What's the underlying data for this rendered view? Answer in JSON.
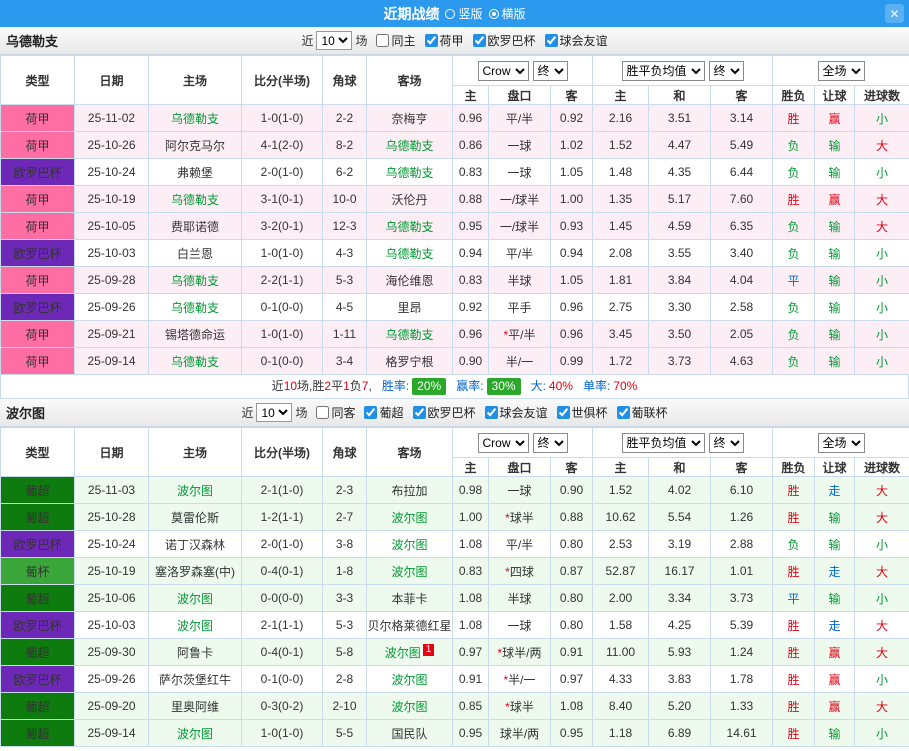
{
  "topbar": {
    "title": "近期战绩",
    "radios": [
      {
        "label": "竖版",
        "selected": false
      },
      {
        "label": "横版",
        "selected": true
      }
    ],
    "close_label": "✕"
  },
  "table_header": {
    "static": [
      "类型",
      "日期",
      "主场",
      "比分(半场)",
      "角球",
      "客场"
    ],
    "groups": [
      {
        "selects": [
          "Crow",
          "终"
        ]
      },
      {
        "selects": [
          "胜平负均值",
          "终"
        ]
      },
      {
        "selects": [
          "全场"
        ]
      }
    ],
    "sub": [
      "主",
      "盘口",
      "客",
      "主",
      "和",
      "客",
      "胜负",
      "让球",
      "进球数"
    ]
  },
  "colors": {
    "topbar_bg": "#2b99ee",
    "league": {
      "荷甲": "#ff6ea2",
      "欧罗巴杯": "#6d28b8",
      "葡超": "#0e7b0e",
      "葡杯": "#3aa63a"
    },
    "row_tint": {
      "荷甲": "#fdeef5",
      "欧罗巴杯": "#ffffff",
      "葡超": "#edfaed",
      "葡杯": "#edfaed"
    },
    "win": "#e60012",
    "loss": "#009933",
    "draw": "#0066cc",
    "score": "#e60012",
    "team_focus": "#009933",
    "badge_bg": "#2aa82a"
  },
  "sections": [
    {
      "team": "乌德勒支",
      "filter": {
        "recent_prefix": "近",
        "recent_value": "10",
        "recent_suffix": "场",
        "checkboxes": [
          {
            "label": "同主",
            "checked": false
          },
          {
            "label": "荷甲",
            "checked": true
          },
          {
            "label": "欧罗巴杯",
            "checked": true
          },
          {
            "label": "球会友谊",
            "checked": true
          }
        ]
      },
      "rows": [
        {
          "league": "荷甲",
          "date": "25-11-02",
          "home": "乌德勒支",
          "score": "1-0(1-0)",
          "corners": "2-2",
          "away": "奈梅亨",
          "o1": "0.96",
          "handicap": "平/半",
          "o2": "0.92",
          "eu1": "2.16",
          "eux": "3.51",
          "eu2": "3.14",
          "res": "胜",
          "hres": "赢",
          "goals": "小"
        },
        {
          "league": "荷甲",
          "date": "25-10-26",
          "home": "阿尔克马尔",
          "score": "4-1(2-0)",
          "corners": "8-2",
          "away": "乌德勒支",
          "o1": "0.86",
          "handicap": "一球",
          "o2": "1.02",
          "eu1": "1.52",
          "eux": "4.47",
          "eu2": "5.49",
          "res": "负",
          "hres": "输",
          "goals": "大"
        },
        {
          "league": "欧罗巴杯",
          "date": "25-10-24",
          "home": "弗赖堡",
          "score": "2-0(1-0)",
          "corners": "6-2",
          "away": "乌德勒支",
          "o1": "0.83",
          "handicap": "一球",
          "o2": "1.05",
          "eu1": "1.48",
          "eux": "4.35",
          "eu2": "6.44",
          "res": "负",
          "hres": "输",
          "goals": "小"
        },
        {
          "league": "荷甲",
          "date": "25-10-19",
          "home": "乌德勒支",
          "score": "3-1(0-1)",
          "corners": "10-0",
          "away": "沃伦丹",
          "o1": "0.88",
          "handicap": "一/球半",
          "o2": "1.00",
          "eu1": "1.35",
          "eux": "5.17",
          "eu2": "7.60",
          "res": "胜",
          "hres": "赢",
          "goals": "大"
        },
        {
          "league": "荷甲",
          "date": "25-10-05",
          "home": "费耶诺德",
          "score": "3-2(0-1)",
          "corners": "12-3",
          "away": "乌德勒支",
          "o1": "0.95",
          "handicap": "一/球半",
          "o2": "0.93",
          "eu1": "1.45",
          "eux": "4.59",
          "eu2": "6.35",
          "res": "负",
          "hres": "输",
          "goals": "大"
        },
        {
          "league": "欧罗巴杯",
          "date": "25-10-03",
          "home": "白兰恩",
          "score": "1-0(1-0)",
          "corners": "4-3",
          "away": "乌德勒支",
          "o1": "0.94",
          "handicap": "平/半",
          "o2": "0.94",
          "eu1": "2.08",
          "eux": "3.55",
          "eu2": "3.40",
          "res": "负",
          "hres": "输",
          "goals": "小"
        },
        {
          "league": "荷甲",
          "date": "25-09-28",
          "home": "乌德勒支",
          "score": "2-2(1-1)",
          "corners": "5-3",
          "away": "海伦维恩",
          "o1": "0.83",
          "handicap": "半球",
          "o2": "1.05",
          "eu1": "1.81",
          "eux": "3.84",
          "eu2": "4.04",
          "res": "平",
          "hres": "输",
          "goals": "小"
        },
        {
          "league": "欧罗巴杯",
          "date": "25-09-26",
          "home": "乌德勒支",
          "score": "0-1(0-0)",
          "corners": "4-5",
          "away": "里昂",
          "o1": "0.92",
          "handicap": "平手",
          "o2": "0.96",
          "eu1": "2.75",
          "eux": "3.30",
          "eu2": "2.58",
          "res": "负",
          "hres": "输",
          "goals": "小"
        },
        {
          "league": "荷甲",
          "date": "25-09-21",
          "home": "锡塔德命运",
          "score": "1-0(1-0)",
          "corners": "1-11",
          "away": "乌德勒支",
          "o1": "0.96",
          "handicap": "*平/半",
          "o2": "0.96",
          "eu1": "3.45",
          "eux": "3.50",
          "eu2": "2.05",
          "res": "负",
          "hres": "输",
          "goals": "小"
        },
        {
          "league": "荷甲",
          "date": "25-09-14",
          "home": "乌德勒支",
          "score": "0-1(0-0)",
          "corners": "3-4",
          "away": "格罗宁根",
          "o1": "0.90",
          "handicap": "半/一",
          "o2": "0.99",
          "eu1": "1.72",
          "eux": "3.73",
          "eu2": "4.63",
          "res": "负",
          "hres": "输",
          "goals": "小"
        }
      ],
      "summary": {
        "games": "10",
        "record": "胜2平1负7",
        "win_rate_label": "胜率:",
        "win_rate": "20%",
        "handicap_rate_label": "赢率:",
        "handicap_rate": "30%",
        "big_label": "大:",
        "big_rate": "40%",
        "single_label": "单率:",
        "single_rate": "70%"
      }
    },
    {
      "team": "波尔图",
      "filter": {
        "recent_prefix": "近",
        "recent_value": "10",
        "recent_suffix": "场",
        "checkboxes": [
          {
            "label": "同客",
            "checked": false
          },
          {
            "label": "葡超",
            "checked": true
          },
          {
            "label": "欧罗巴杯",
            "checked": true
          },
          {
            "label": "球会友谊",
            "checked": true
          },
          {
            "label": "世俱杯",
            "checked": true
          },
          {
            "label": "葡联杯",
            "checked": true
          }
        ]
      },
      "rows": [
        {
          "league": "葡超",
          "date": "25-11-03",
          "home": "波尔图",
          "score": "2-1(1-0)",
          "corners": "2-3",
          "away": "布拉加",
          "o1": "0.98",
          "handicap": "一球",
          "o2": "0.90",
          "eu1": "1.52",
          "eux": "4.02",
          "eu2": "6.10",
          "res": "胜",
          "hres": "走",
          "goals": "大"
        },
        {
          "league": "葡超",
          "date": "25-10-28",
          "home": "莫雷伦斯",
          "score": "1-2(1-1)",
          "corners": "2-7",
          "away": "波尔图",
          "o1": "1.00",
          "handicap": "*球半",
          "o2": "0.88",
          "eu1": "10.62",
          "eux": "5.54",
          "eu2": "1.26",
          "res": "胜",
          "hres": "输",
          "goals": "大"
        },
        {
          "league": "欧罗巴杯",
          "date": "25-10-24",
          "home": "诺丁汉森林",
          "score": "2-0(1-0)",
          "corners": "3-8",
          "away": "波尔图",
          "o1": "1.08",
          "handicap": "平/半",
          "o2": "0.80",
          "eu1": "2.53",
          "eux": "3.19",
          "eu2": "2.88",
          "res": "负",
          "hres": "输",
          "goals": "小"
        },
        {
          "league": "葡杯",
          "date": "25-10-19",
          "home": "塞洛罗森塞(中)",
          "score": "0-4(0-1)",
          "corners": "1-8",
          "away": "波尔图",
          "o1": "0.83",
          "handicap": "*四球",
          "o2": "0.87",
          "eu1": "52.87",
          "eux": "16.17",
          "eu2": "1.01",
          "res": "胜",
          "hres": "走",
          "goals": "大"
        },
        {
          "league": "葡超",
          "date": "25-10-06",
          "home": "波尔图",
          "score": "0-0(0-0)",
          "corners": "3-3",
          "away": "本菲卡",
          "o1": "1.08",
          "handicap": "半球",
          "o2": "0.80",
          "eu1": "2.00",
          "eux": "3.34",
          "eu2": "3.73",
          "res": "平",
          "hres": "输",
          "goals": "小"
        },
        {
          "league": "欧罗巴杯",
          "date": "25-10-03",
          "home": "波尔图",
          "score": "2-1(1-1)",
          "corners": "5-3",
          "away": "贝尔格莱德红星",
          "o1": "1.08",
          "handicap": "一球",
          "o2": "0.80",
          "eu1": "1.58",
          "eux": "4.25",
          "eu2": "5.39",
          "res": "胜",
          "hres": "走",
          "goals": "大"
        },
        {
          "league": "葡超",
          "date": "25-09-30",
          "home": "阿鲁卡",
          "score": "0-4(0-1)",
          "corners": "5-8",
          "away": "波尔图",
          "away_card": "1",
          "o1": "0.97",
          "handicap": "*球半/两",
          "o2": "0.91",
          "eu1": "11.00",
          "eux": "5.93",
          "eu2": "1.24",
          "res": "胜",
          "hres": "赢",
          "goals": "大"
        },
        {
          "league": "欧罗巴杯",
          "date": "25-09-26",
          "home": "萨尔茨堡红牛",
          "score": "0-1(0-0)",
          "corners": "2-8",
          "away": "波尔图",
          "o1": "0.91",
          "handicap": "*半/一",
          "o2": "0.97",
          "eu1": "4.33",
          "eux": "3.83",
          "eu2": "1.78",
          "res": "胜",
          "hres": "赢",
          "goals": "小"
        },
        {
          "league": "葡超",
          "date": "25-09-20",
          "home": "里奥阿维",
          "score": "0-3(0-2)",
          "corners": "2-10",
          "away": "波尔图",
          "o1": "0.85",
          "handicap": "*球半",
          "o2": "1.08",
          "eu1": "8.40",
          "eux": "5.20",
          "eu2": "1.33",
          "res": "胜",
          "hres": "赢",
          "goals": "大"
        },
        {
          "league": "葡超",
          "date": "25-09-14",
          "home": "波尔图",
          "score": "1-0(1-0)",
          "corners": "5-5",
          "away": "国民队",
          "o1": "0.95",
          "handicap": "球半/两",
          "o2": "0.95",
          "eu1": "1.18",
          "eux": "6.89",
          "eu2": "14.61",
          "res": "胜",
          "hres": "输",
          "goals": "小"
        }
      ]
    }
  ]
}
